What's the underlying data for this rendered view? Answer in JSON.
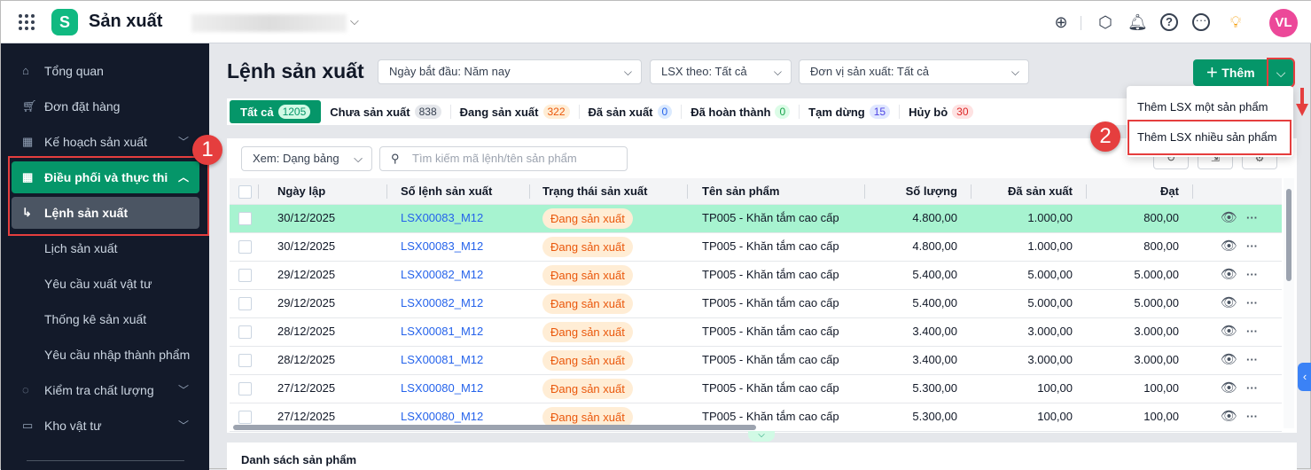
{
  "app": {
    "title": "Sản xuất",
    "avatar": "VL",
    "icons": [
      "download-icon",
      "box-icon",
      "bell-icon",
      "help-icon",
      "more-icon",
      "idea-icon"
    ]
  },
  "sidebar": {
    "items": [
      {
        "label": "Tổng quan",
        "icon": "home-icon"
      },
      {
        "label": "Đơn đặt hàng",
        "icon": "cart-icon"
      },
      {
        "label": "Kế hoạch sản xuất",
        "icon": "calendar-gear-icon",
        "expandable": true
      },
      {
        "label": "Điều phối và thực thi",
        "icon": "calendar-clock-icon",
        "expandable": true,
        "active": true
      },
      {
        "label": "Lệnh sản xuất",
        "sub": true,
        "selected": true
      },
      {
        "label": "Lịch sản xuất",
        "sub": true
      },
      {
        "label": "Yêu cầu xuất vật tư",
        "sub": true
      },
      {
        "label": "Thống kê sản xuất",
        "sub": true
      },
      {
        "label": "Yêu cầu nhập thành phẩm",
        "sub": true
      },
      {
        "label": "Kiểm tra chất lượng",
        "icon": "check-circle-icon",
        "expandable": true
      },
      {
        "label": "Kho vật tư",
        "icon": "archive-icon",
        "expandable": true
      }
    ]
  },
  "page": {
    "title": "Lệnh sản xuất",
    "filters": {
      "start_date": "Ngày bắt đầu: Năm nay",
      "lsx_by": "LSX theo: Tất cả",
      "unit": "Đơn vị sản xuất: Tất cả"
    },
    "add_label": "Thêm",
    "add_menu": [
      "Thêm LSX một sản phẩm",
      "Thêm LSX nhiều sản phẩm"
    ]
  },
  "tabs": [
    {
      "label": "Tất cả",
      "count": "1205"
    },
    {
      "label": "Chưa sản xuất",
      "count": "838"
    },
    {
      "label": "Đang sản xuất",
      "count": "322"
    },
    {
      "label": "Đã sản xuất",
      "count": "0"
    },
    {
      "label": "Đã hoàn thành",
      "count": "0"
    },
    {
      "label": "Tạm dừng",
      "count": "15"
    },
    {
      "label": "Hủy bỏ",
      "count": "30"
    }
  ],
  "toolbar": {
    "view": "Xem: Dạng bảng",
    "search_placeholder": "Tìm kiếm mã lệnh/tên sản phẩm"
  },
  "table": {
    "columns": [
      "Ngày lập",
      "Số lệnh sản xuất",
      "Trạng thái sản xuất",
      "Tên sản phẩm",
      "Số lượng",
      "Đã sản xuất",
      "Đạt"
    ],
    "rows": [
      [
        "30/12/2025",
        "LSX00083_M12",
        "Đang sản xuất",
        "TP005 - Khăn tắm cao cấp",
        "4.800,00",
        "1.000,00",
        "800,00"
      ],
      [
        "30/12/2025",
        "LSX00083_M12",
        "Đang sản xuất",
        "TP005 - Khăn tắm cao cấp",
        "4.800,00",
        "1.000,00",
        "800,00"
      ],
      [
        "29/12/2025",
        "LSX00082_M12",
        "Đang sản xuất",
        "TP005 - Khăn tắm cao cấp",
        "5.400,00",
        "5.000,00",
        "5.000,00"
      ],
      [
        "29/12/2025",
        "LSX00082_M12",
        "Đang sản xuất",
        "TP005 - Khăn tắm cao cấp",
        "5.400,00",
        "5.000,00",
        "5.000,00"
      ],
      [
        "28/12/2025",
        "LSX00081_M12",
        "Đang sản xuất",
        "TP005 - Khăn tắm cao cấp",
        "3.400,00",
        "3.000,00",
        "3.000,00"
      ],
      [
        "28/12/2025",
        "LSX00081_M12",
        "Đang sản xuất",
        "TP005 - Khăn tắm cao cấp",
        "3.400,00",
        "3.000,00",
        "3.000,00"
      ],
      [
        "27/12/2025",
        "LSX00080_M12",
        "Đang sản xuất",
        "TP005 - Khăn tắm cao cấp",
        "5.300,00",
        "100,00",
        "100,00"
      ],
      [
        "27/12/2025",
        "LSX00080_M12",
        "Đang sản xuất",
        "TP005 - Khăn tắm cao cấp",
        "5.300,00",
        "100,00",
        "100,00"
      ]
    ]
  },
  "bottom": {
    "title": "Danh sách sản phẩm"
  },
  "annotations": {
    "step1": "1",
    "step2": "2"
  },
  "colors": {
    "brand": "#059669",
    "highlight_row": "#a7f3d0",
    "sidebar": "#131a2a",
    "annotation": "#e53e3e"
  }
}
